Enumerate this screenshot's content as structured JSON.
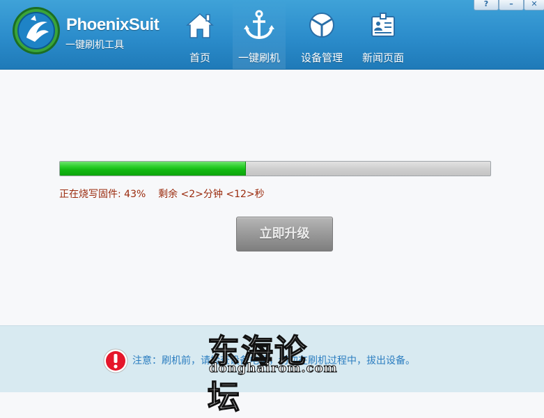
{
  "header": {
    "brand": "PhoenixSuit",
    "subtitle": "一键刷机工具",
    "nav": [
      {
        "label": "首页",
        "icon": "home-icon"
      },
      {
        "label": "一键刷机",
        "icon": "anchor-icon"
      },
      {
        "label": "设备管理",
        "icon": "device-icon"
      },
      {
        "label": "新闻页面",
        "icon": "news-icon"
      }
    ],
    "active_nav": "一键刷机",
    "window_buttons": [
      {
        "label": "?",
        "icon": "help-icon"
      },
      {
        "label": "–",
        "icon": "minimize-icon"
      },
      {
        "label": "✕",
        "icon": "close-icon"
      }
    ]
  },
  "flash": {
    "progress_percent": 43,
    "status_text": "正在烧写固件: 43%    剩余 <2>分钟 <12>秒",
    "upgrade_button": "立即升级"
  },
  "footer": {
    "notice": "注意：刷机前，请检查设备电量，切勿在刷机过程中，拔出设备。",
    "watermark_main": "东海论坛",
    "watermark_sub": "donghairom.com"
  },
  "colors": {
    "header_blue": "#2b8ccb",
    "progress_green": "#12b812",
    "status_red": "#9a2a0c",
    "notice_blue": "#2b7dc0",
    "footer_bg": "#d8eaf1"
  }
}
